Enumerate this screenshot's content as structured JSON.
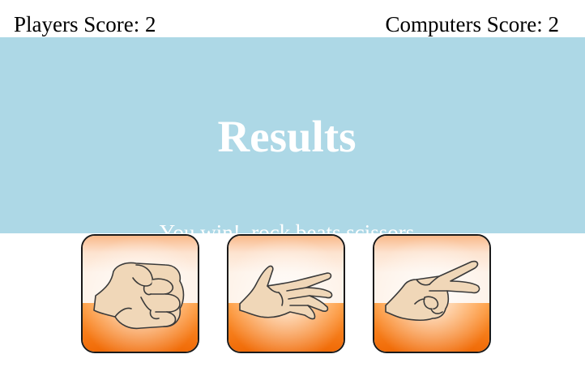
{
  "scores": {
    "player_label": "Players Score: 2",
    "computer_label": "Computers Score: 2",
    "player": 2,
    "computer": 2
  },
  "results": {
    "title": "Results",
    "message": "You win!, rock beats scissors"
  },
  "choices": [
    {
      "icon": "rock-fist-icon",
      "value": "rock"
    },
    {
      "icon": "paper-hand-icon",
      "value": "paper"
    },
    {
      "icon": "scissors-hand-icon",
      "value": "scissors"
    }
  ],
  "colors": {
    "panel_background": "#add8e6",
    "panel_text": "#ffffff",
    "button_top": "#fde2cc",
    "button_bottom": "#f57c12",
    "hand_skin": "#f0d7b8",
    "hand_outline": "#3a3a3a"
  }
}
